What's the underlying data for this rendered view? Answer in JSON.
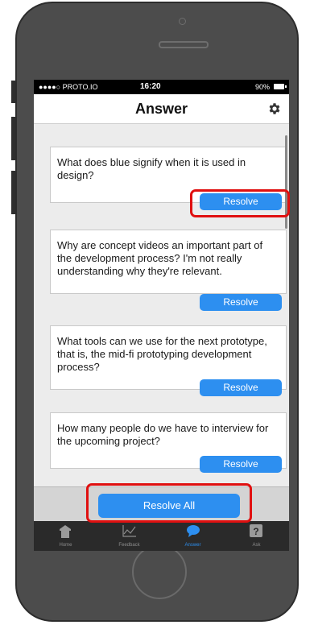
{
  "status_bar": {
    "carrier": "●●●●○ PROTO.IO",
    "time": "16:20",
    "battery": "90%"
  },
  "header": {
    "title": "Answer"
  },
  "questions": [
    {
      "text": "What does blue signify when it is used in design?",
      "action": "Resolve"
    },
    {
      "text": "Why are concept videos an important part of the development process? I'm not really understanding why they're relevant.",
      "action": "Resolve"
    },
    {
      "text": "What tools can we use for the next prototype, that is, the mid-fi prototyping development process?",
      "action": "Resolve"
    },
    {
      "text": "How many people do we have to interview for the upcoming project?",
      "action": "Resolve"
    }
  ],
  "footer": {
    "resolve_all": "Resolve All"
  },
  "tabs": [
    {
      "label": "Home",
      "icon": "home-icon"
    },
    {
      "label": "Feedback",
      "icon": "chart-icon"
    },
    {
      "label": "Answer",
      "icon": "chat-bubble-icon",
      "active": true
    },
    {
      "label": "Ask",
      "icon": "question-icon"
    }
  ],
  "colors": {
    "accent": "#2d8ff0",
    "highlight": "#e01010",
    "tabbar": "#2a2a2a"
  }
}
